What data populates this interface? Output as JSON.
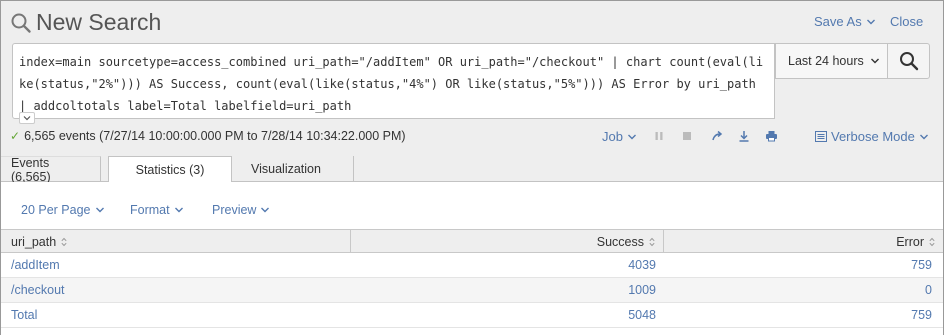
{
  "header": {
    "title": "New Search",
    "save_as": "Save As",
    "close": "Close"
  },
  "search": {
    "query": "index=main sourcetype=access_combined uri_path=\"/addItem\" OR uri_path=\"/checkout\" | chart count(eval(like(status,\"2%\"))) AS Success, count(eval(like(status,\"4%\") OR like(status,\"5%\"))) AS Error by uri_path | addcoltotals label=Total labelfield=uri_path",
    "time_range": "Last 24 hours"
  },
  "status": {
    "summary": "6,565 events (7/27/14 10:00:00.000 PM to 7/28/14 10:34:22.000 PM)",
    "job": "Job",
    "mode": "Verbose Mode"
  },
  "tabs": [
    {
      "label": "Events (6,565)"
    },
    {
      "label": "Statistics (3)"
    },
    {
      "label": "Visualization"
    }
  ],
  "options": {
    "per_page": "20 Per Page",
    "format": "Format",
    "preview": "Preview"
  },
  "table": {
    "columns": [
      "uri_path",
      "Success",
      "Error"
    ],
    "rows": [
      [
        "/addItem",
        "4039",
        "759"
      ],
      [
        "/checkout",
        "1009",
        "0"
      ],
      [
        "Total",
        "5048",
        "759"
      ]
    ]
  },
  "colors": {
    "link": "#5379af",
    "success_check": "#65a637",
    "header_bg": "#eeeeee"
  }
}
